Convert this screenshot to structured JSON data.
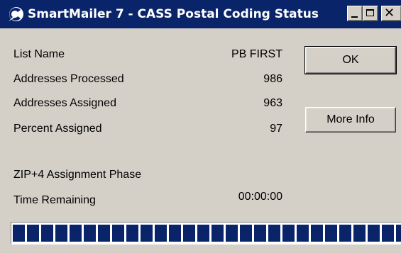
{
  "window": {
    "title": "SmartMailer 7 - CASS Postal Coding Status",
    "icon": "smartmailer-app-icon",
    "controls": {
      "minimize": "minimize-icon",
      "maximize": "maximize-icon",
      "close": "✕"
    }
  },
  "status": {
    "list_name_label": "List Name",
    "list_name_value": "PB FIRST",
    "processed_label": "Addresses Processed",
    "processed_value": "986",
    "assigned_label": "Addresses Assigned",
    "assigned_value": "963",
    "percent_label": "Percent Assigned",
    "percent_value": "97",
    "phase_label": "ZIP+4 Assignment Phase",
    "time_label": "Time Remaining",
    "time_value": "00:00:00"
  },
  "buttons": {
    "ok": "OK",
    "more_info": "More Info"
  },
  "progress": {
    "fraction": 1.0
  },
  "colors": {
    "titlebar": "#0a246a",
    "face": "#d4d0c8",
    "progress_block": "#0a246a"
  }
}
